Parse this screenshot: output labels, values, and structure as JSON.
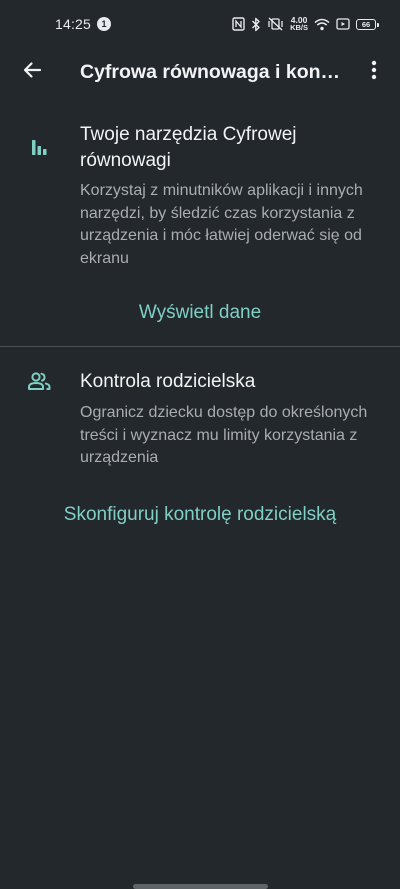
{
  "status_bar": {
    "time": "14:25",
    "notification_count": "1",
    "net_speed_value": "4.00",
    "net_speed_unit": "KB/S",
    "battery_level": "66"
  },
  "app_bar": {
    "title": "Cyfrowa równowaga i kontrola rodzicielska",
    "back_icon": "arrow-back-icon",
    "more_icon": "more-vert-icon"
  },
  "digital_wellbeing": {
    "icon": "bar-chart-icon",
    "title": "Twoje narzędzia Cyfrowej równowagi",
    "description": "Korzystaj z minutników aplikacji i innych narzędzi, by śledzić czas korzystania z urządzenia i móc łatwiej oderwać się od ekranu",
    "action_label": "Wyświetl dane"
  },
  "parental_controls": {
    "icon": "people-icon",
    "title": "Kontrola rodzicielska",
    "description": "Ogranicz dziecku dostęp do określonych treści i wyznacz mu limity korzystania z urządzenia",
    "action_label": "Skonfiguruj kontrolę rodzicielską"
  },
  "colors": {
    "background": "#23282c",
    "accent": "#7fcfc4",
    "text_primary": "#f1f3f4",
    "text_secondary": "#a9adb1"
  }
}
